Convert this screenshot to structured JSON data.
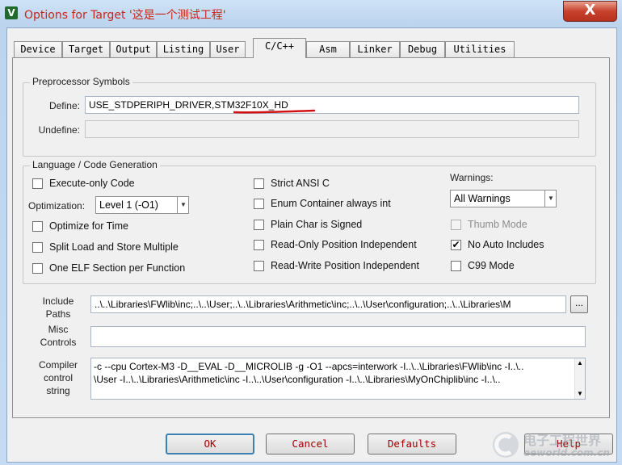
{
  "window": {
    "title": "Options for Target '这是一个测试工程'",
    "close_label": "X"
  },
  "tabs": [
    "Device",
    "Target",
    "Output",
    "Listing",
    "User",
    "C/C++",
    "Asm",
    "Linker",
    "Debug",
    "Utilities"
  ],
  "active_tab": "C/C++",
  "preprocessor": {
    "title": "Preprocessor Symbols",
    "define_label": "Define:",
    "define_value": "USE_STDPERIPH_DRIVER,STM32F10X_HD",
    "undefine_label": "Undefine:",
    "undefine_value": ""
  },
  "language": {
    "title": "Language / Code Generation",
    "execute_only": {
      "label": "Execute-only Code",
      "checked": false
    },
    "optimization_label": "Optimization:",
    "optimization_value": "Level 1 (-O1)",
    "optimize_time": {
      "label": "Optimize for Time",
      "checked": false
    },
    "split_load": {
      "label": "Split Load and Store Multiple",
      "checked": false
    },
    "one_elf": {
      "label": "One ELF Section per Function",
      "checked": false
    },
    "strict_ansi": {
      "label": "Strict ANSI C",
      "checked": false
    },
    "enum_container": {
      "label": "Enum Container always int",
      "checked": false
    },
    "plain_char": {
      "label": "Plain Char is Signed",
      "checked": false
    },
    "ro_position": {
      "label": "Read-Only Position Independent",
      "checked": false
    },
    "rw_position": {
      "label": "Read-Write Position Independent",
      "checked": false
    },
    "warnings_label": "Warnings:",
    "warnings_value": "All Warnings",
    "thumb_mode": {
      "label": "Thumb Mode",
      "checked": false,
      "disabled": true
    },
    "no_auto_includes": {
      "label": "No Auto Includes",
      "checked": true
    },
    "c99_mode": {
      "label": "C99 Mode",
      "checked": false
    }
  },
  "include": {
    "label_line1": "Include",
    "label_line2": "Paths",
    "value": "..\\..\\Libraries\\FWlib\\inc;..\\..\\User;..\\..\\Libraries\\Arithmetic\\inc;..\\..\\User\\configuration;..\\..\\Libraries\\M",
    "browse_label": "..."
  },
  "misc": {
    "label_line1": "Misc",
    "label_line2": "Controls",
    "value": ""
  },
  "compiler": {
    "label_line1": "Compiler",
    "label_line2": "control",
    "label_line3": "string",
    "line1": "-c --cpu Cortex-M3 -D__EVAL -D__MICROLIB -g -O1 --apcs=interwork -I..\\..\\Libraries\\FWlib\\inc -I..\\..",
    "line2": "\\User -I..\\..\\Libraries\\Arithmetic\\inc -I..\\..\\User\\configuration -I..\\..\\Libraries\\MyOnChiplib\\inc -I..\\.."
  },
  "buttons": {
    "ok": "OK",
    "cancel": "Cancel",
    "defaults": "Defaults",
    "help": "Help"
  },
  "watermark": {
    "line1": "电子工程世界",
    "line2": "eeworld.com.cn"
  },
  "colors": {
    "title_text": "#c4281a",
    "button_text": "#a00000",
    "annotation_red": "#d21010"
  }
}
